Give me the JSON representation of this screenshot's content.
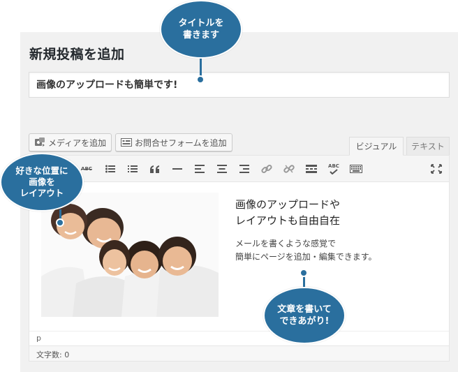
{
  "page": {
    "title": "新規投稿を追加"
  },
  "post_title": {
    "value": "画像のアップロードも簡単です!"
  },
  "media_buttons": {
    "add_media": "メディアを追加",
    "add_contact_form": "お問合せフォームを追加"
  },
  "editor_tabs": {
    "visual": "ビジュアル",
    "text": "テキスト"
  },
  "toolbar": {
    "strikethrough_label": "ABC",
    "spellcheck_label": "ABC"
  },
  "content": {
    "heading_line1": "画像のアップロードや",
    "heading_line2": "レイアウトも自由自在",
    "body_line1": "メールを書くような感覚で",
    "body_line2": "簡単にページを追加・編集できます。"
  },
  "status": {
    "path": "p",
    "word_count": "文字数: 0"
  },
  "callouts": {
    "title": {
      "line1": "タイトルを",
      "line2": "書きます"
    },
    "layout": {
      "line1": "好きな位置に",
      "line2": "画像を",
      "line3": "レイアウト"
    },
    "done": {
      "line1": "文章を書いて",
      "line2": "できあがり!"
    }
  },
  "colors": {
    "callout": "#2a6f9e",
    "panel_bg": "#f1f1f1"
  }
}
